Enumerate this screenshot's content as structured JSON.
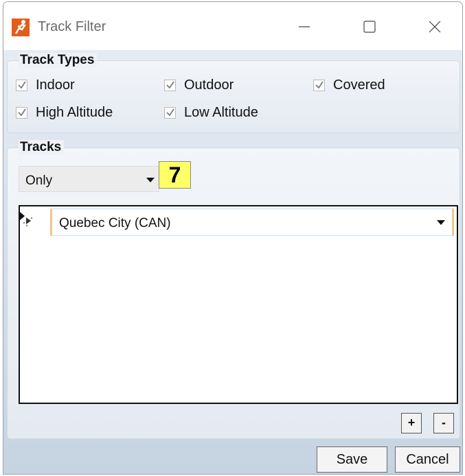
{
  "window": {
    "title": "Track Filter",
    "icon": "app-icon",
    "controls": [
      "minimize-icon",
      "maximize-icon",
      "close-icon"
    ]
  },
  "track_types": {
    "header": "Track Types",
    "options": [
      {
        "label": "Indoor",
        "checked": true
      },
      {
        "label": "Outdoor",
        "checked": true
      },
      {
        "label": "Covered",
        "checked": true
      },
      {
        "label": "High Altitude",
        "checked": true
      },
      {
        "label": "Low Altitude",
        "checked": true
      }
    ]
  },
  "tracks": {
    "header": "Tracks",
    "filter_mode": "Only",
    "count": "7",
    "rows": [
      {
        "value": "Quebec City (CAN)"
      }
    ],
    "add_label": "+",
    "remove_label": "-"
  },
  "footer": {
    "save_label": "Save",
    "cancel_label": "Cancel"
  },
  "colors": {
    "highlight_badge": "#ffff66",
    "accent_border": "#f2c48c"
  }
}
